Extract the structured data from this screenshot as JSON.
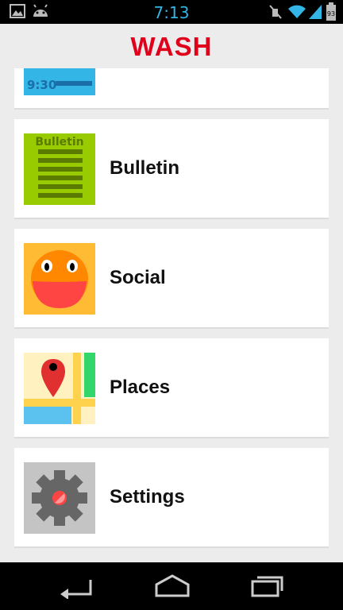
{
  "status_bar": {
    "time": "7:13",
    "battery_level": "93",
    "left_icons": [
      "picture-icon",
      "android-icon"
    ],
    "right_icons": [
      "mute-icon",
      "wifi-icon",
      "signal-icon",
      "battery-icon"
    ]
  },
  "app_bar": {
    "title": "WASH",
    "title_color": "#e0001b"
  },
  "menu": {
    "items": [
      {
        "label": "",
        "icon": "clock-icon",
        "icon_text": "9:30"
      },
      {
        "label": "Bulletin",
        "icon": "bulletin-icon",
        "icon_text": "Bulletin"
      },
      {
        "label": "Social",
        "icon": "smiley-icon"
      },
      {
        "label": "Places",
        "icon": "map-pin-icon"
      },
      {
        "label": "Settings",
        "icon": "gear-icon"
      }
    ]
  },
  "nav_bar": {
    "buttons": [
      "back-icon",
      "home-icon",
      "recents-icon"
    ]
  }
}
